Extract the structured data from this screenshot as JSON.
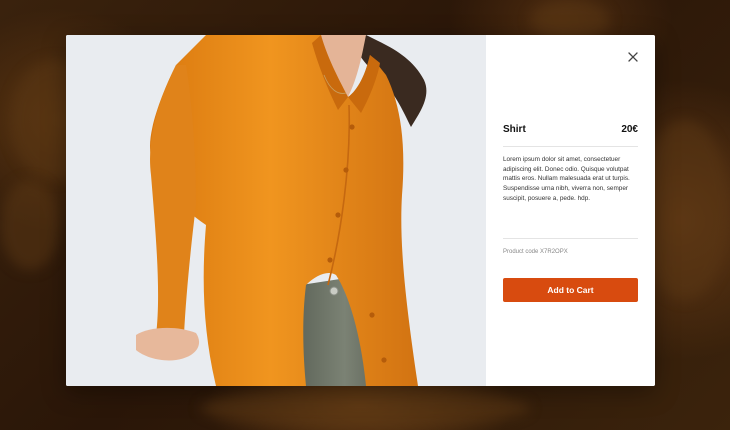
{
  "product": {
    "name": "Shirt",
    "price": "20€",
    "description": "Lorem ipsum dolor sit amet, consectetuer adipiscing elit. Donec odio. Quisque volutpat mattis eros. Nullam malesuada erat ut turpis. Suspendisse urna nibh, viverra non, semper suscipit, posuere a, pede. hdp.",
    "product_code": "Product code X7R2OPX",
    "image_alt": "Model wearing an orange button-up shirt with grey trousers"
  },
  "actions": {
    "add_to_cart_label": "Add to Cart",
    "close_icon": "close-icon"
  },
  "colors": {
    "accent": "#d84b0f",
    "shirt": "#e8891c",
    "backdrop": "#2a1608"
  }
}
